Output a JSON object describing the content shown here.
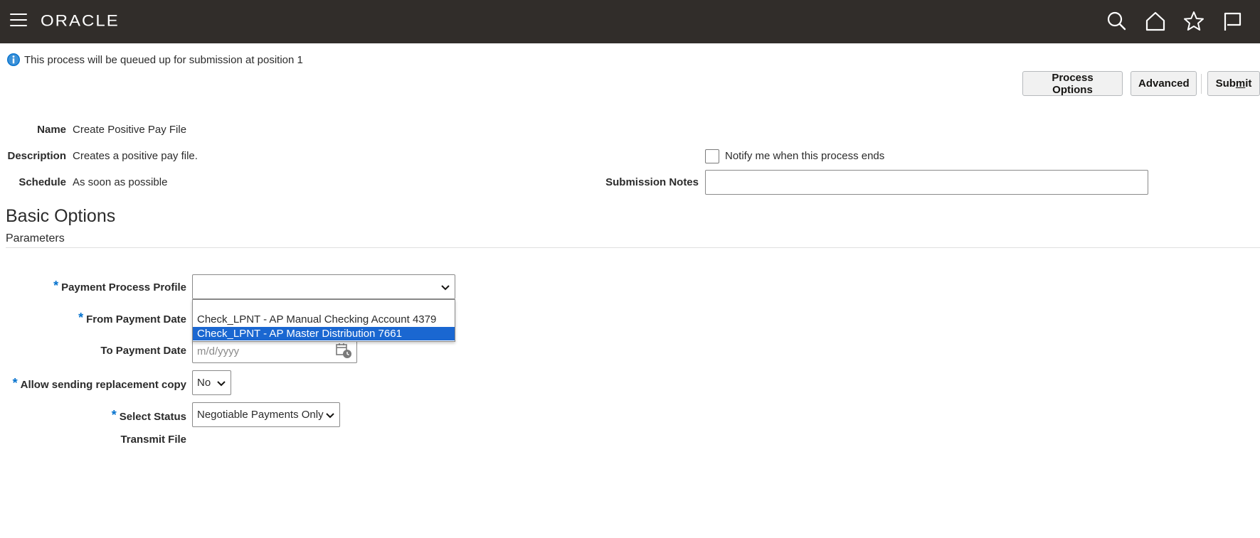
{
  "brand": {
    "logo_text": "ORACLE",
    "bar_color": "#312d2a",
    "accent": "#0572ce",
    "selection": "#1a67d1"
  },
  "header_icons": [
    "search-icon",
    "home-icon",
    "favorites-star-icon",
    "notifications-flag-icon"
  ],
  "info": {
    "message": "This process will be queued up for submission at position 1",
    "icon": "info-icon"
  },
  "actions": {
    "process_options": "Process Options",
    "advanced": "Advanced",
    "submit_pre": "Sub",
    "submit_mid": "m",
    "submit_post": "it"
  },
  "details": {
    "name_label": "Name",
    "name_value": "Create Positive Pay File",
    "description_label": "Description",
    "description_value": "Creates a positive pay file.",
    "schedule_label": "Schedule",
    "schedule_value": "As soon as possible",
    "notify_label": "Notify me when this process ends",
    "notes_label": "Submission Notes",
    "notes_value": ""
  },
  "section": {
    "title": "Basic Options",
    "subtitle": "Parameters"
  },
  "params": {
    "required_mark": "*",
    "payment_profile_label": "Payment Process Profile",
    "payment_profile_value": "",
    "payment_profile_options": [
      "Check_LPNT - AP Manual Checking Account 4379",
      "Check_LPNT - AP Master Distribution 7661"
    ],
    "selected_option_index": 1,
    "from_date_label": "From Payment Date",
    "to_date_label": "To Payment Date",
    "to_date_placeholder": "m/d/yyyy",
    "allow_replacement_label": "Allow sending replacement copy",
    "allow_replacement_value": "No",
    "select_status_label": "Select Status",
    "select_status_value": "Negotiable Payments Only",
    "transmit_label": "Transmit File"
  }
}
